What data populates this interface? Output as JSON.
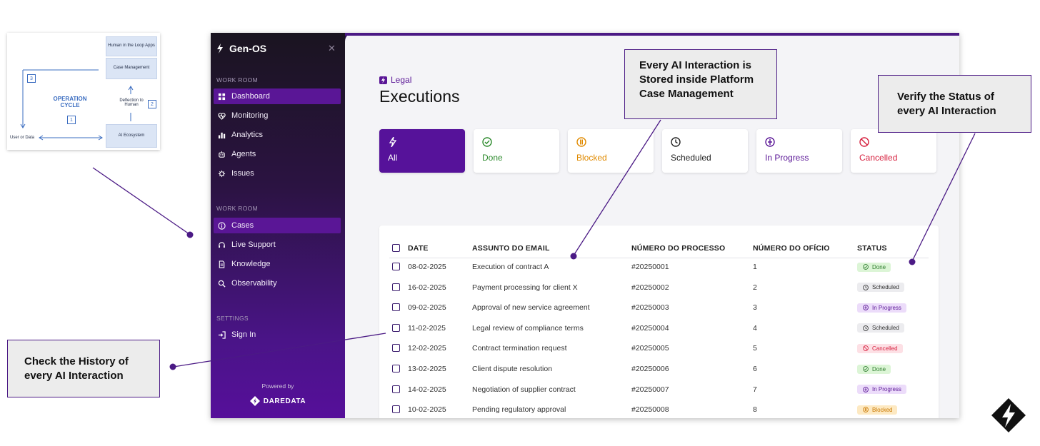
{
  "diagram": {
    "top_box": "Human in the Loop Apps",
    "case_box": "Case Management",
    "deflection": "Deflection to Human",
    "ecosystem_box": "AI Ecosystem",
    "cycle_label": "OPERATION CYCLE",
    "left_label": "User or Data",
    "step1": "1",
    "step2": "2",
    "step3": "3"
  },
  "sidebar": {
    "app_title": "Gen-OS",
    "section_workroom_1": "WORK ROOM",
    "items_top": [
      {
        "label": "Dashboard",
        "icon": "grid-icon",
        "active": true
      },
      {
        "label": "Monitoring",
        "icon": "heartbeat-icon",
        "active": false
      },
      {
        "label": "Analytics",
        "icon": "bar-chart-icon",
        "active": false
      },
      {
        "label": "Agents",
        "icon": "robot-icon",
        "active": false
      },
      {
        "label": "Issues",
        "icon": "bug-icon",
        "active": false
      }
    ],
    "section_workroom_2": "WORK ROOM",
    "items_mid": [
      {
        "label": "Cases",
        "icon": "info-icon",
        "active": true
      },
      {
        "label": "Live Support",
        "icon": "headset-icon",
        "active": false
      },
      {
        "label": "Knowledge",
        "icon": "document-icon",
        "active": false
      },
      {
        "label": "Observability",
        "icon": "search-icon",
        "active": false
      }
    ],
    "section_settings": "SETTINGS",
    "sign_in": "Sign In",
    "powered_by": "Powered by",
    "company": "DAREDATA"
  },
  "main": {
    "breadcrumb": "Legal",
    "title": "Executions",
    "filters": [
      {
        "label": "All",
        "icon": "bolt-icon",
        "color": "#ffffff",
        "selected": true
      },
      {
        "label": "Done",
        "icon": "check-circle-icon",
        "color": "#2e8b2e",
        "selected": false
      },
      {
        "label": "Blocked",
        "icon": "blocked-icon",
        "color": "#e08a00",
        "selected": false
      },
      {
        "label": "Scheduled",
        "icon": "clock-icon",
        "color": "#222222",
        "selected": false
      },
      {
        "label": "In Progress",
        "icon": "progress-icon",
        "color": "#5a1696",
        "selected": false
      },
      {
        "label": "Cancelled",
        "icon": "cancel-icon",
        "color": "#d6213f",
        "selected": false
      }
    ],
    "table": {
      "headers": {
        "date": "DATE",
        "subject": "ASSUNTO DO EMAIL",
        "process": "NÚMERO DO PROCESSO",
        "office": "NÚMERO DO OFÍCIO",
        "status": "STATUS"
      },
      "rows": [
        {
          "date": "08-02-2025",
          "subject": "Execution of contract A",
          "process": "#20250001",
          "office": "1",
          "status": "Done"
        },
        {
          "date": "16-02-2025",
          "subject": "Payment processing for client X",
          "process": "#20250002",
          "office": "2",
          "status": "Scheduled"
        },
        {
          "date": "09-02-2025",
          "subject": "Approval of new service agreement",
          "process": "#20250003",
          "office": "3",
          "status": "In Progress"
        },
        {
          "date": "11-02-2025",
          "subject": "Legal review of compliance terms",
          "process": "#20250004",
          "office": "4",
          "status": "Scheduled"
        },
        {
          "date": "12-02-2025",
          "subject": "Contract termination request",
          "process": "#20250005",
          "office": "5",
          "status": "Cancelled"
        },
        {
          "date": "13-02-2025",
          "subject": "Client dispute resolution",
          "process": "#20250006",
          "office": "6",
          "status": "Done"
        },
        {
          "date": "14-02-2025",
          "subject": "Negotiation of supplier contract",
          "process": "#20250007",
          "office": "7",
          "status": "In Progress"
        },
        {
          "date": "10-02-2025",
          "subject": "Pending regulatory approval",
          "process": "#20250008",
          "office": "8",
          "status": "Blocked"
        }
      ]
    },
    "status_styles": {
      "Done": {
        "bg": "#dcf5d6",
        "fg": "#2e7d2e",
        "icon": "check-circle-icon"
      },
      "Scheduled": {
        "bg": "#ececef",
        "fg": "#333333",
        "icon": "clock-icon"
      },
      "In Progress": {
        "bg": "#ecdcfa",
        "fg": "#5a1696",
        "icon": "progress-icon"
      },
      "Cancelled": {
        "bg": "#fde0e5",
        "fg": "#d6213f",
        "icon": "cancel-icon"
      },
      "Blocked": {
        "bg": "#fde9c2",
        "fg": "#c97800",
        "icon": "blocked-icon"
      }
    }
  },
  "callouts": {
    "stored": "Every AI Interaction is Stored inside Platform Case Management",
    "verify": "Verify the Status of every AI Interaction",
    "history": "Check the History of every AI Interaction"
  },
  "accent": "#56129a"
}
